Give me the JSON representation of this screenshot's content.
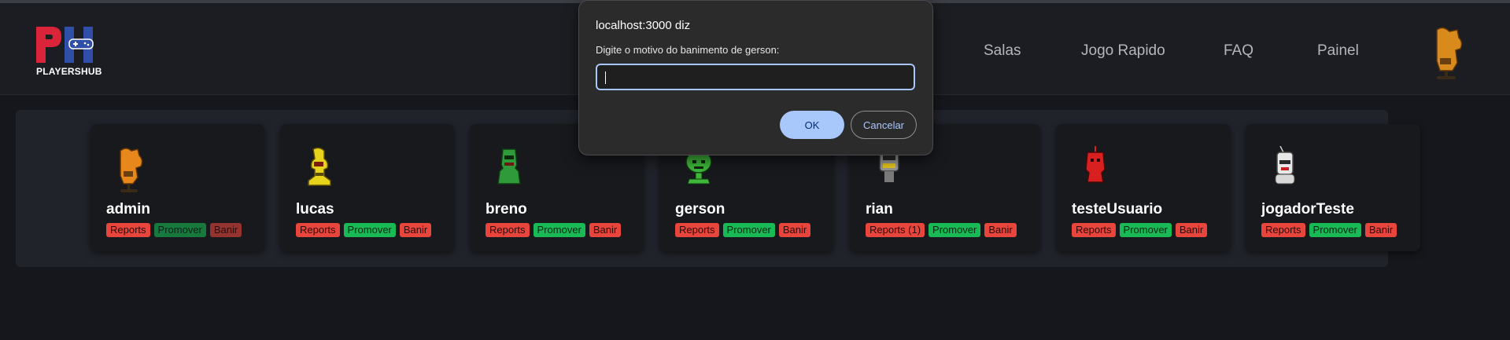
{
  "brand": {
    "logo_text": "PLAYERSHUB"
  },
  "nav": {
    "items": [
      {
        "label": "Salas"
      },
      {
        "label": "Jogo Rapido"
      },
      {
        "label": "FAQ"
      },
      {
        "label": "Painel"
      }
    ]
  },
  "users": [
    {
      "name": "admin",
      "avatar_color": "#e8881c",
      "reports": "Reports",
      "promote": "Promover",
      "ban": "Banir",
      "actions_disabled": true
    },
    {
      "name": "lucas",
      "avatar_color": "#e8d31c",
      "reports": "Reports",
      "promote": "Promover",
      "ban": "Banir",
      "actions_disabled": false
    },
    {
      "name": "breno",
      "avatar_color": "#2f9a3a",
      "reports": "Reports",
      "promote": "Promover",
      "ban": "Banir",
      "actions_disabled": false
    },
    {
      "name": "gerson",
      "avatar_color": "#3fb83a",
      "reports": "Reports",
      "promote": "Promover",
      "ban": "Banir",
      "actions_disabled": false
    },
    {
      "name": "rian",
      "avatar_color": "#9a9a9a",
      "reports": "Reports (1)",
      "promote": "Promover",
      "ban": "Banir",
      "actions_disabled": false
    },
    {
      "name": "testeUsuario",
      "avatar_color": "#d82020",
      "reports": "Reports",
      "promote": "Promover",
      "ban": "Banir",
      "actions_disabled": false
    },
    {
      "name": "jogadorTeste",
      "avatar_color": "#e8e8e8",
      "reports": "Reports",
      "promote": "Promover",
      "ban": "Banir",
      "actions_disabled": false
    }
  ],
  "dialog": {
    "title": "localhost:3000 diz",
    "message": "Digite o motivo do banimento de gerson:",
    "input_value": "",
    "ok_label": "OK",
    "cancel_label": "Cancelar"
  },
  "colors": {
    "accent": "#a8c7fa",
    "danger": "#e8453c",
    "success": "#19b955",
    "background": "#15171c"
  }
}
